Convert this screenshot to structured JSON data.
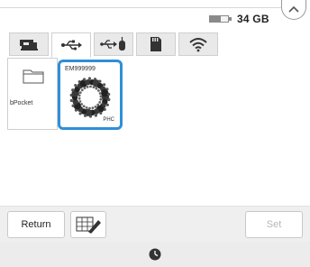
{
  "header": {
    "storage_free": "34 GB",
    "storage_used_fraction": 0.6,
    "close_icon": "chevron-up-icon"
  },
  "tabs": [
    {
      "icon": "embroidery-machine-icon",
      "active": false
    },
    {
      "icon": "usb-icon",
      "active": true
    },
    {
      "icon": "usb-mouse-icon",
      "active": false
    },
    {
      "icon": "sd-card-icon",
      "active": false
    },
    {
      "icon": "wifi-icon",
      "active": false
    }
  ],
  "files": {
    "folder": {
      "label": "bPocket",
      "icon": "folder-icon"
    },
    "embroidery": {
      "name": "EM999999",
      "type": "PHC",
      "selected": true
    }
  },
  "footer": {
    "return_label": "Return",
    "set_label": "Set",
    "edit_icon": "edit-pattern-icon",
    "status_icon": "clock-icon"
  },
  "colors": {
    "selection_border": "#2f8fd8",
    "disabled_text": "#b8b8b8",
    "bar_background": "#efefef"
  }
}
